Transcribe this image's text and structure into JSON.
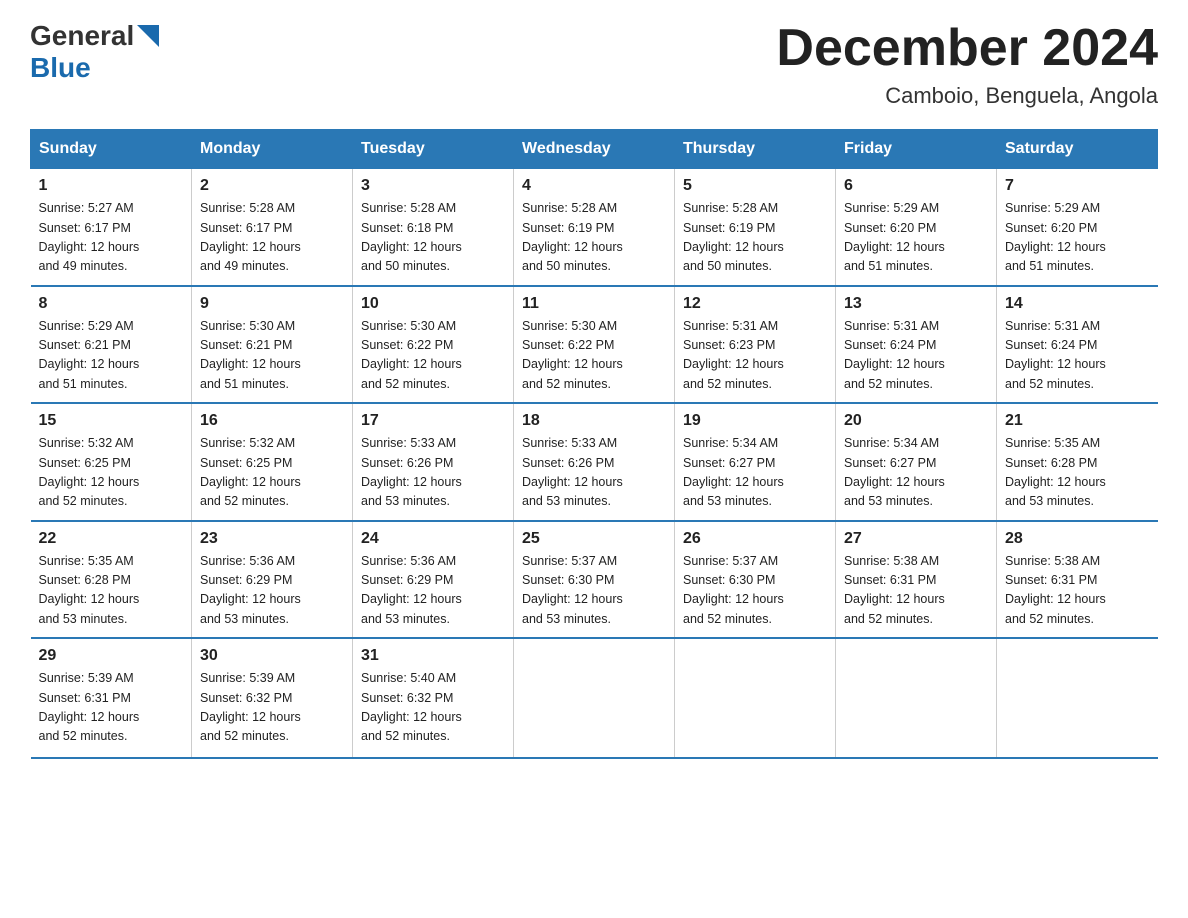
{
  "logo": {
    "general": "General",
    "blue": "Blue",
    "triangle": "▶"
  },
  "title": "December 2024",
  "subtitle": "Camboio, Benguela, Angola",
  "days_header": [
    "Sunday",
    "Monday",
    "Tuesday",
    "Wednesday",
    "Thursday",
    "Friday",
    "Saturday"
  ],
  "weeks": [
    [
      {
        "day": "1",
        "sunrise": "5:27 AM",
        "sunset": "6:17 PM",
        "daylight": "12 hours and 49 minutes."
      },
      {
        "day": "2",
        "sunrise": "5:28 AM",
        "sunset": "6:17 PM",
        "daylight": "12 hours and 49 minutes."
      },
      {
        "day": "3",
        "sunrise": "5:28 AM",
        "sunset": "6:18 PM",
        "daylight": "12 hours and 50 minutes."
      },
      {
        "day": "4",
        "sunrise": "5:28 AM",
        "sunset": "6:19 PM",
        "daylight": "12 hours and 50 minutes."
      },
      {
        "day": "5",
        "sunrise": "5:28 AM",
        "sunset": "6:19 PM",
        "daylight": "12 hours and 50 minutes."
      },
      {
        "day": "6",
        "sunrise": "5:29 AM",
        "sunset": "6:20 PM",
        "daylight": "12 hours and 51 minutes."
      },
      {
        "day": "7",
        "sunrise": "5:29 AM",
        "sunset": "6:20 PM",
        "daylight": "12 hours and 51 minutes."
      }
    ],
    [
      {
        "day": "8",
        "sunrise": "5:29 AM",
        "sunset": "6:21 PM",
        "daylight": "12 hours and 51 minutes."
      },
      {
        "day": "9",
        "sunrise": "5:30 AM",
        "sunset": "6:21 PM",
        "daylight": "12 hours and 51 minutes."
      },
      {
        "day": "10",
        "sunrise": "5:30 AM",
        "sunset": "6:22 PM",
        "daylight": "12 hours and 52 minutes."
      },
      {
        "day": "11",
        "sunrise": "5:30 AM",
        "sunset": "6:22 PM",
        "daylight": "12 hours and 52 minutes."
      },
      {
        "day": "12",
        "sunrise": "5:31 AM",
        "sunset": "6:23 PM",
        "daylight": "12 hours and 52 minutes."
      },
      {
        "day": "13",
        "sunrise": "5:31 AM",
        "sunset": "6:24 PM",
        "daylight": "12 hours and 52 minutes."
      },
      {
        "day": "14",
        "sunrise": "5:31 AM",
        "sunset": "6:24 PM",
        "daylight": "12 hours and 52 minutes."
      }
    ],
    [
      {
        "day": "15",
        "sunrise": "5:32 AM",
        "sunset": "6:25 PM",
        "daylight": "12 hours and 52 minutes."
      },
      {
        "day": "16",
        "sunrise": "5:32 AM",
        "sunset": "6:25 PM",
        "daylight": "12 hours and 52 minutes."
      },
      {
        "day": "17",
        "sunrise": "5:33 AM",
        "sunset": "6:26 PM",
        "daylight": "12 hours and 53 minutes."
      },
      {
        "day": "18",
        "sunrise": "5:33 AM",
        "sunset": "6:26 PM",
        "daylight": "12 hours and 53 minutes."
      },
      {
        "day": "19",
        "sunrise": "5:34 AM",
        "sunset": "6:27 PM",
        "daylight": "12 hours and 53 minutes."
      },
      {
        "day": "20",
        "sunrise": "5:34 AM",
        "sunset": "6:27 PM",
        "daylight": "12 hours and 53 minutes."
      },
      {
        "day": "21",
        "sunrise": "5:35 AM",
        "sunset": "6:28 PM",
        "daylight": "12 hours and 53 minutes."
      }
    ],
    [
      {
        "day": "22",
        "sunrise": "5:35 AM",
        "sunset": "6:28 PM",
        "daylight": "12 hours and 53 minutes."
      },
      {
        "day": "23",
        "sunrise": "5:36 AM",
        "sunset": "6:29 PM",
        "daylight": "12 hours and 53 minutes."
      },
      {
        "day": "24",
        "sunrise": "5:36 AM",
        "sunset": "6:29 PM",
        "daylight": "12 hours and 53 minutes."
      },
      {
        "day": "25",
        "sunrise": "5:37 AM",
        "sunset": "6:30 PM",
        "daylight": "12 hours and 53 minutes."
      },
      {
        "day": "26",
        "sunrise": "5:37 AM",
        "sunset": "6:30 PM",
        "daylight": "12 hours and 52 minutes."
      },
      {
        "day": "27",
        "sunrise": "5:38 AM",
        "sunset": "6:31 PM",
        "daylight": "12 hours and 52 minutes."
      },
      {
        "day": "28",
        "sunrise": "5:38 AM",
        "sunset": "6:31 PM",
        "daylight": "12 hours and 52 minutes."
      }
    ],
    [
      {
        "day": "29",
        "sunrise": "5:39 AM",
        "sunset": "6:31 PM",
        "daylight": "12 hours and 52 minutes."
      },
      {
        "day": "30",
        "sunrise": "5:39 AM",
        "sunset": "6:32 PM",
        "daylight": "12 hours and 52 minutes."
      },
      {
        "day": "31",
        "sunrise": "5:40 AM",
        "sunset": "6:32 PM",
        "daylight": "12 hours and 52 minutes."
      },
      null,
      null,
      null,
      null
    ]
  ]
}
